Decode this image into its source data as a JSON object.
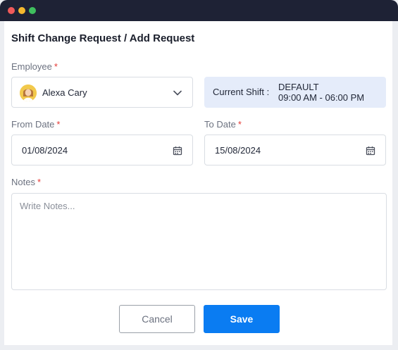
{
  "window": {
    "controls": [
      "close",
      "minimize",
      "maximize"
    ]
  },
  "page": {
    "title": "Shift Change Request / Add Request"
  },
  "form": {
    "employee": {
      "label": "Employee",
      "required_mark": "*",
      "value": "Alexa Cary",
      "icon": "chevron-down-icon"
    },
    "current_shift": {
      "label": "Current Shift :",
      "name": "DEFAULT",
      "time": "09:00 AM - 06:00 PM"
    },
    "from_date": {
      "label": "From Date",
      "required_mark": "*",
      "value": "01/08/2024",
      "icon": "calendar-icon"
    },
    "to_date": {
      "label": "To Date",
      "required_mark": "*",
      "value": "15/08/2024",
      "icon": "calendar-icon"
    },
    "notes": {
      "label": "Notes",
      "required_mark": "*",
      "placeholder": "Write Notes..."
    }
  },
  "actions": {
    "cancel_label": "Cancel",
    "save_label": "Save"
  },
  "colors": {
    "primary": "#0a7cf2",
    "required": "#e53935",
    "titlebar": "#1e2235",
    "shift_bg": "#e5ecfa"
  }
}
